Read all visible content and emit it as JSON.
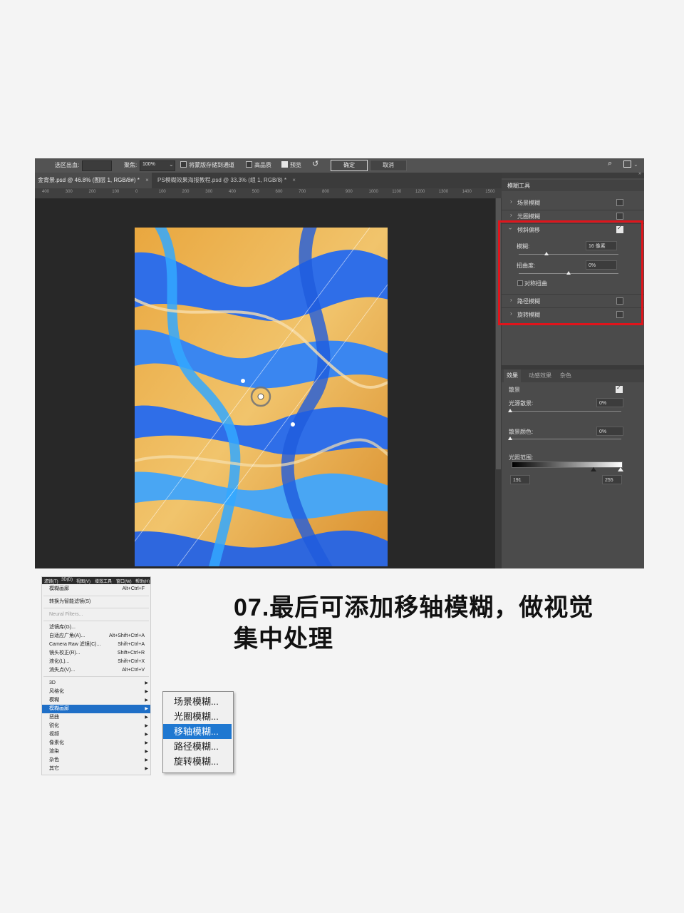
{
  "options_bar": {
    "selection_output_label": "选区出血:",
    "focus_label": "聚焦:",
    "focus_value": "100%",
    "save_mask_label": "将蒙版存储到通道",
    "high_quality_label": "高品质",
    "preview_label": "预览",
    "ok_label": "确定",
    "cancel_label": "取消"
  },
  "tabs": [
    {
      "label": "金背景.psd @ 46.8% (图层 1, RGB/8#) *"
    },
    {
      "label": "PS模糊效果海报教程.psd @ 33.3% (组 1, RGB/8) *"
    }
  ],
  "ruler_ticks": [
    "400",
    "300",
    "200",
    "100",
    "0",
    "100",
    "200",
    "300",
    "400",
    "500",
    "600",
    "700",
    "800",
    "900",
    "1000",
    "1100",
    "1200",
    "1300",
    "1400",
    "1500"
  ],
  "blur_tools": {
    "title": "模糊工具",
    "items": [
      {
        "label": "场景模糊",
        "checked": false
      },
      {
        "label": "光圈模糊",
        "checked": false
      },
      {
        "label": "倾斜偏移",
        "checked": true
      },
      {
        "label": "路径模糊",
        "checked": false
      },
      {
        "label": "旋转模糊",
        "checked": false
      }
    ],
    "blur_label": "模糊:",
    "blur_value": "16 像素",
    "blur_level": 0.28,
    "distortion_label": "扭曲度:",
    "distortion_value": "0%",
    "distortion_level": 0.5,
    "symmetric_label": "对称扭曲"
  },
  "effects": {
    "tabs": [
      "效果",
      "动感效果",
      "杂色"
    ],
    "bokeh_label": "散景",
    "bokeh_checked": true,
    "light_bokeh_label": "光源散景:",
    "light_bokeh_value": "0%",
    "bokeh_color_label": "散景颜色:",
    "bokeh_color_value": "0%",
    "light_range_label": "光照范围:",
    "light_range_low": "191",
    "light_range_high": "255"
  },
  "menubar": [
    "滤镜(T)",
    "3D(D)",
    "视图(V)",
    "增效工具",
    "窗口(W)",
    "帮助(H)"
  ],
  "filter_menu": [
    {
      "label": "模糊画廊",
      "shortcut": "Alt+Ctrl+F"
    },
    {
      "label": "转换为智能滤镜(S)",
      "shortcut": ""
    },
    {
      "label": "Neural Filters...",
      "shortcut": ""
    },
    {
      "label": "滤镜库(G)...",
      "shortcut": ""
    },
    {
      "label": "自适应广角(A)...",
      "shortcut": "Alt+Shift+Ctrl+A"
    },
    {
      "label": "Camera Raw 滤镜(C)...",
      "shortcut": "Shift+Ctrl+A"
    },
    {
      "label": "镜头校正(R)...",
      "shortcut": "Shift+Ctrl+R"
    },
    {
      "label": "液化(L)...",
      "shortcut": "Shift+Ctrl+X"
    },
    {
      "label": "消失点(V)...",
      "shortcut": "Alt+Ctrl+V"
    },
    {
      "label": "3D",
      "shortcut": ""
    },
    {
      "label": "风格化",
      "shortcut": ""
    },
    {
      "label": "模糊",
      "shortcut": ""
    },
    {
      "label": "模糊画廊",
      "shortcut": ""
    },
    {
      "label": "扭曲",
      "shortcut": ""
    },
    {
      "label": "锐化",
      "shortcut": ""
    },
    {
      "label": "视频",
      "shortcut": ""
    },
    {
      "label": "像素化",
      "shortcut": ""
    },
    {
      "label": "渲染",
      "shortcut": ""
    },
    {
      "label": "杂色",
      "shortcut": ""
    },
    {
      "label": "其它",
      "shortcut": ""
    }
  ],
  "blur_gallery_submenu": [
    "场景模糊...",
    "光圈模糊...",
    "移轴模糊...",
    "路径模糊...",
    "旋转模糊..."
  ],
  "caption": {
    "line1": "07.最后可添加移轴模糊，做视觉",
    "line2": "集中处理"
  },
  "colors": {
    "highlight_red": "#e0141b",
    "menu_highlight": "#1f78d1",
    "canvas_blue": "#2f6ee8",
    "canvas_gold": "#e7a63e"
  }
}
